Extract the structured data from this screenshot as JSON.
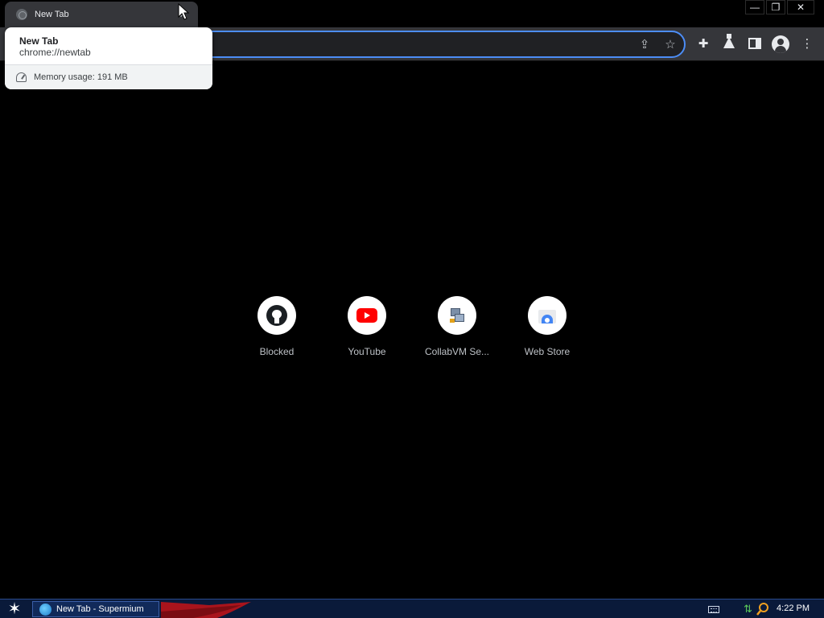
{
  "browser": {
    "tab": {
      "title": "New Tab"
    },
    "window_controls": {
      "minimize": "—",
      "restore": "❐",
      "close": "✕"
    }
  },
  "hover_card": {
    "title": "New Tab",
    "url": "chrome://newtab",
    "memory": "Memory usage: 191 MB"
  },
  "shortcuts": [
    {
      "label": "Blocked",
      "icon": "github-icon"
    },
    {
      "label": "YouTube",
      "icon": "youtube-icon"
    },
    {
      "label": "CollabVM Se...",
      "icon": "collabvm-icon"
    },
    {
      "label": "Web Store",
      "icon": "web-store-icon"
    }
  ],
  "taskbar": {
    "task_label": "New Tab - Supermium",
    "clock": "4:22 PM"
  },
  "colors": {
    "accent": "#4c8df6",
    "toolbar": "#35363a",
    "background": "#000000",
    "taskbar": "#0a1a3a",
    "youtube_red": "#ff0000"
  }
}
